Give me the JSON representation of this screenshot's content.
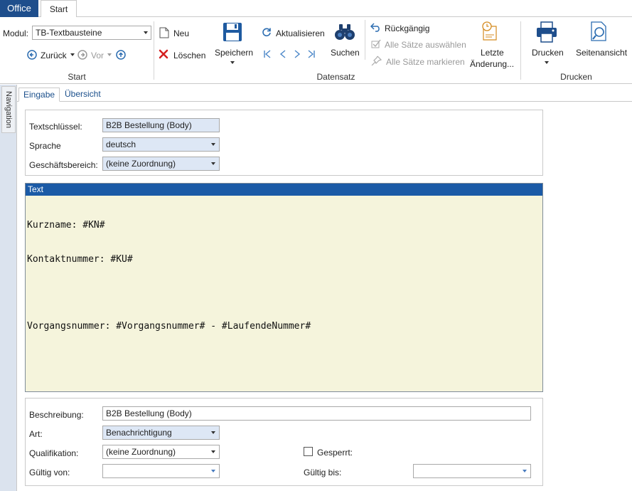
{
  "tabs": {
    "office": "Office",
    "start": "Start"
  },
  "ribbon": {
    "modul_label": "Modul:",
    "modul_value": "TB-Textbausteine",
    "back_label": "Zurück",
    "forward_label": "Vor",
    "start_group": "Start",
    "new_label": "Neu",
    "delete_label": "Löschen",
    "save_label": "Speichern",
    "refresh_label": "Aktualisieren",
    "search_label": "Suchen",
    "datensatz_group": "Datensatz",
    "undo_label": "Rückgängig",
    "select_all_label": "Alle Sätze auswählen",
    "mark_all_label": "Alle Sätze markieren",
    "last_changes_line1": "Letzte",
    "last_changes_line2": "Änderung...",
    "print_label": "Drucken",
    "preview_label": "Seitenansicht",
    "print_group": "Drucken"
  },
  "nav": {
    "label": "Navigation"
  },
  "subtabs": {
    "input": "Eingabe",
    "overview": "Übersicht"
  },
  "top_form": {
    "key_label": "Textschlüssel:",
    "key_value": "B2B Bestellung (Body)",
    "language_label": "Sprache",
    "language_value": "deutsch",
    "area_label": "Geschäftsbereich:",
    "area_value": "(keine Zuordnung)"
  },
  "text_panel": {
    "header": "Text",
    "lines": [
      "Kurzname: #KN#",
      "Kontaktnummer: #KU#",
      "",
      "Vorgangsnummer: #Vorgangsnummer# - #LaufendeNummer#"
    ]
  },
  "bottom_form": {
    "desc_label": "Beschreibung:",
    "desc_value": "B2B Bestellung (Body)",
    "type_label": "Art:",
    "type_value": "Benachrichtigung",
    "qual_label": "Qualifikation:",
    "qual_value": "(keine Zuordnung)",
    "locked_label": "Gesperrt:",
    "valid_from_label": "Gültig von:",
    "valid_from_value": "",
    "valid_to_label": "Gültig bis:",
    "valid_to_value": ""
  },
  "colors": {
    "accent": "#1e4e8c",
    "text_header": "#1b5aa6",
    "text_bg": "#f5f4dc",
    "field_bg": "#dde7f5",
    "delete_red": "#d42020"
  }
}
